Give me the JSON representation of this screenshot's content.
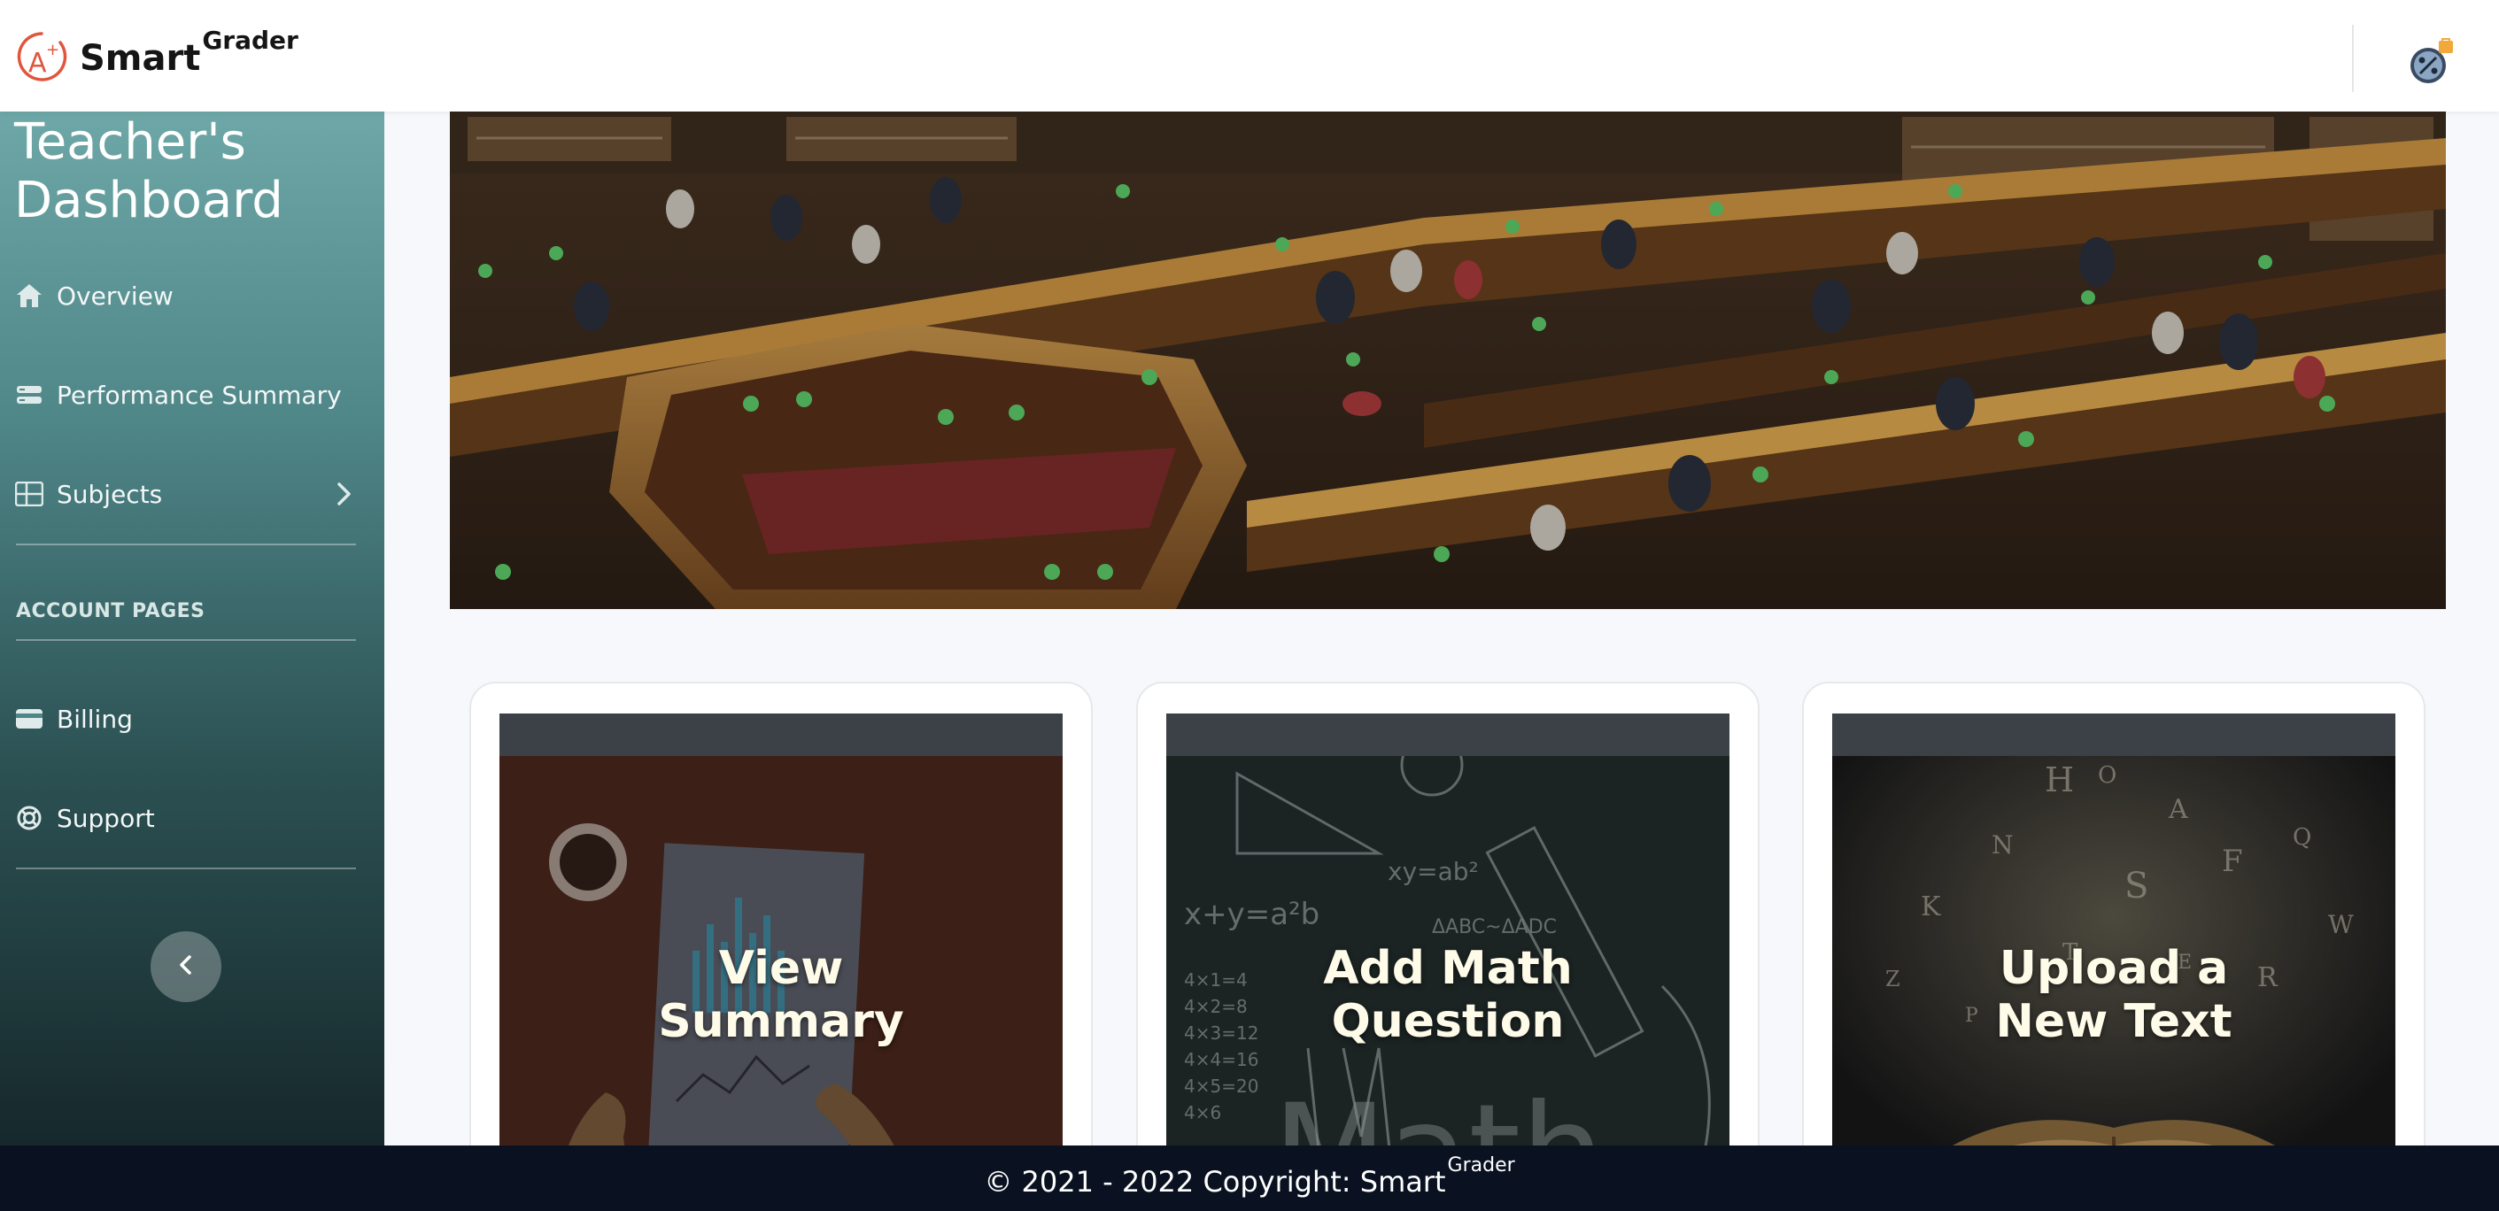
{
  "brand": {
    "name": "Smart",
    "superscript": "Grader",
    "logo_icon": "a-plus-grade-icon",
    "accent_color": "#e0563d"
  },
  "header": {
    "profile_icon": "user-avatar-icon",
    "notification_badge_color": "#f2a93b"
  },
  "sidebar": {
    "title": "Teacher's Dashboard",
    "items": [
      {
        "label": "Overview",
        "icon": "home-icon"
      },
      {
        "label": "Performance Summary",
        "icon": "list-icon"
      },
      {
        "label": "Subjects",
        "icon": "grid-icon",
        "has_chevron": true
      }
    ],
    "account_section": {
      "heading": "ACCOUNT PAGES",
      "items": [
        {
          "label": "Billing",
          "icon": "credit-card-icon"
        },
        {
          "label": "Support",
          "icon": "lifebuoy-icon"
        }
      ]
    },
    "collapse_icon": "chevron-left-icon"
  },
  "hero": {
    "image": "library-reading-room-photo"
  },
  "cards": [
    {
      "title": "View\nSummary",
      "image": "report-charts-illustration"
    },
    {
      "title": "Add Math\nQuestion",
      "image": "math-chalkboard-illustration"
    },
    {
      "title": "Upload a\nNew Text",
      "image": "open-book-letters-illustration"
    }
  ],
  "footer": {
    "text": "© 2021 - 2022 Copyright: Smart",
    "superscript": "Grader"
  }
}
